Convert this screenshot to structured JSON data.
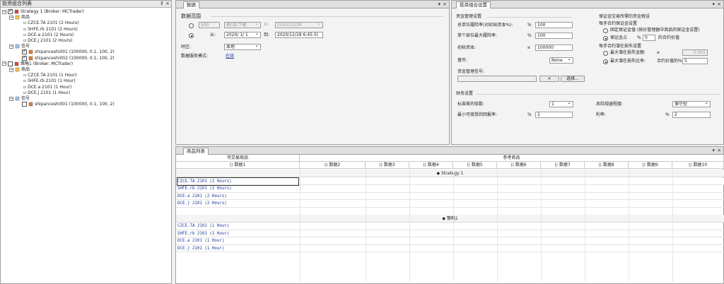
{
  "left_panel": {
    "title": "投资组合列表",
    "controls": [
      "⇕",
      "×"
    ],
    "strategies": [
      {
        "name": "Strategy 1 (Broker: MCTrader)",
        "checked": true,
        "products_label": "商品",
        "products": [
          "CZCE.TA 2101 (2 Hours)",
          "SHFE.rb 2101 (2 Hours)",
          "DCE.a 2101 (2 Hours)",
          "DCE.j 2101 (2 Hours)"
        ],
        "signals_label": "信号",
        "signals": [
          {
            "name": "shipanceshi001 (100000, 0.1, 100, 2)",
            "checked": true
          },
          {
            "name": "shipanceshi002 (100000, 0.1, 100, 2)",
            "checked": true
          }
        ]
      },
      {
        "name": "策略1 (Broker: MCTrader)",
        "checked": false,
        "products_label": "商品",
        "products": [
          "CZCE.TA 2101 (1 Hour)",
          "SHFE.rb 2101 (1 Hour)",
          "DCE.a 2101 (1 Hour)",
          "DCE.j 2101 (1 Hour)"
        ],
        "signals_label": "信号",
        "signals": [
          {
            "name": "shipanceshi001 (100000, 0.1, 100, 2)",
            "checked": false
          }
        ]
      }
    ]
  },
  "data_panel": {
    "tab": "数据",
    "controls": [
      "▾",
      "×"
    ],
    "section_title": "数据范围",
    "row1": {
      "count": "500",
      "unit": "根(或)下载",
      "from_label": "从:",
      "from_value": "2020/12/28"
    },
    "row2": {
      "from_label": "从:",
      "from_value": "2020/ 1/ 1",
      "to_label": "到:",
      "to_value": "2020/12/28  6:45:5("
    },
    "timezone_label": "时区:",
    "timezone_value": "本地",
    "service_label": "数据服务模式:",
    "service_value": "在线"
  },
  "portfolio_settings": {
    "tab": "投资组合设置",
    "controls": [
      "▾",
      "×"
    ],
    "money_title": "资金管理设置",
    "fields": [
      {
        "label": "总单位履险率(对初始资本%):",
        "unit": "%",
        "value": "100"
      },
      {
        "label": "单个部位最大履险率:",
        "unit": "%",
        "value": "100"
      },
      {
        "label": "初始资本:",
        "unit": "¤",
        "value": "100000"
      }
    ],
    "base_label": "基币:",
    "base_value": "None",
    "signal_label": "资金管理信号:",
    "signal_btn_x": "×",
    "signal_btn_select": "选择...",
    "margin_title": "保证金交易所需的资金假设",
    "per_contract_title": "每手合约保证金设置",
    "opt_fixed": "固定保证金值 (按价管理器中商品的保证金设置)",
    "opt_ratio": "保证金占",
    "ratio_unit": "%",
    "ratio_value": "0",
    "ratio_suffix": "的合约价值",
    "loss_title": "每手合约潜在损失设置",
    "opt_max_amount": "最大潜在损失金额:",
    "amount_unit": "¤",
    "amount_value": "0.001",
    "opt_max_ratio": "最大潜在损失比率:",
    "max_ratio_mid": "合约价值的%",
    "max_ratio_value": "5",
    "finance_title": "财务设置",
    "std_dev_label": "标准差的倍数:",
    "std_dev_value": "1",
    "min_return_label": "最小可接受的回报率:",
    "min_return_unit": "%",
    "min_return_value": "2",
    "risk_label": "风险规避程度:",
    "risk_value": "保守型",
    "rate_label": "利率:",
    "rate_unit": "%",
    "rate_value": "2"
  },
  "products_list": {
    "tab": "商品列表",
    "controls": [
      "▾",
      "×"
    ],
    "col_tradable": "可交易商品",
    "col_ref": "参考商品",
    "data_headers": [
      "数据1",
      "数据2",
      "数据3",
      "数据4",
      "数据5",
      "数据6",
      "数据7",
      "数据8",
      "数据9",
      "数据10"
    ],
    "groups": [
      {
        "name": "Strategy 1",
        "items": [
          "CZCE.TA 2101 (2 Hours)",
          "SHFE.rb 2101 (2 Hours)",
          "DCE.a 2101 (2 Hours)",
          "DCE.j 2101 (2 Hours)"
        ]
      },
      {
        "name": "策略1",
        "items": [
          "CZCE.TA 2101 (1 Hour)",
          "SHFE.rb 2101 (1 Hour)",
          "DCE.a 2101 (1 Hour)",
          "DCE.j 2101 (1 Hour)"
        ]
      }
    ]
  }
}
